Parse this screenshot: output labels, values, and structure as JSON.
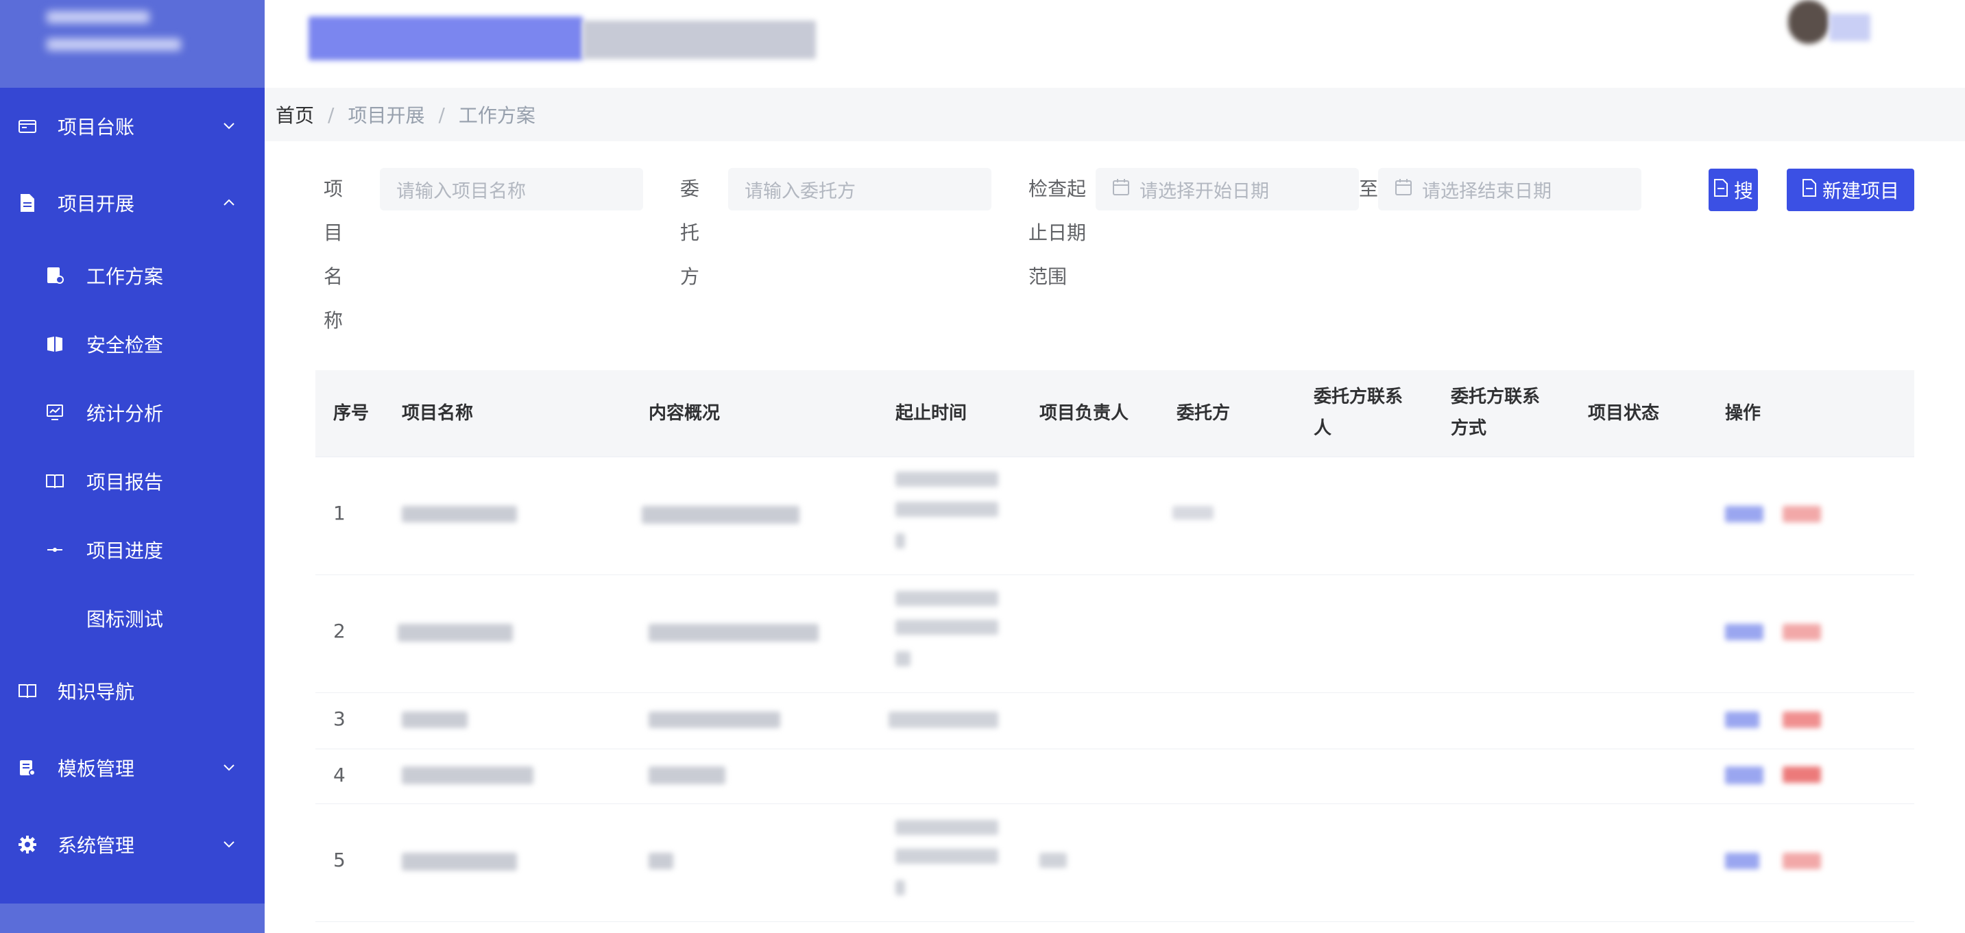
{
  "sidebar": {
    "items": [
      {
        "label": "项目台账",
        "icon": "ledger-icon",
        "expanded": false
      },
      {
        "label": "项目开展",
        "icon": "document-icon",
        "expanded": true
      },
      {
        "label": "工作方案",
        "icon": "plan-icon"
      },
      {
        "label": "安全检查",
        "icon": "book-shield-icon"
      },
      {
        "label": "统计分析",
        "icon": "monitor-chart-icon"
      },
      {
        "label": "项目报告",
        "icon": "open-book-icon"
      },
      {
        "label": "项目进度",
        "icon": "progress-icon"
      },
      {
        "label": "图标测试",
        "icon": ""
      },
      {
        "label": "知识导航",
        "icon": "open-book-icon"
      },
      {
        "label": "模板管理",
        "icon": "template-icon",
        "expanded": false
      },
      {
        "label": "系统管理",
        "icon": "gear-icon",
        "expanded": false
      }
    ]
  },
  "breadcrumb": {
    "home": "首页",
    "level1": "项目开展",
    "current": "工作方案",
    "separator": "/"
  },
  "filters": {
    "project_name_label": "项目名称",
    "project_name_placeholder": "请输入项目名称",
    "client_label": "委托方",
    "client_placeholder": "请输入委托方",
    "date_range_label": "检查起止日期范围",
    "start_placeholder": "请选择开始日期",
    "to_label": "至",
    "end_placeholder": "请选择结束日期",
    "search_button": "搜",
    "new_button": "新建项目"
  },
  "table": {
    "columns": [
      "序号",
      "项目名称",
      "内容概况",
      "起止时间",
      "项目负责人",
      "委托方",
      "委托方联系人",
      "委托方联系方式",
      "项目状态",
      "操作"
    ],
    "rows": [
      {
        "index": "1"
      },
      {
        "index": "2"
      },
      {
        "index": "3"
      },
      {
        "index": "4"
      },
      {
        "index": "5"
      }
    ]
  },
  "colors": {
    "sidebar": "#3547d3",
    "sidebar_logo": "#5b6dd9",
    "primary": "#3b50e4",
    "danger": "#f56c6c"
  }
}
